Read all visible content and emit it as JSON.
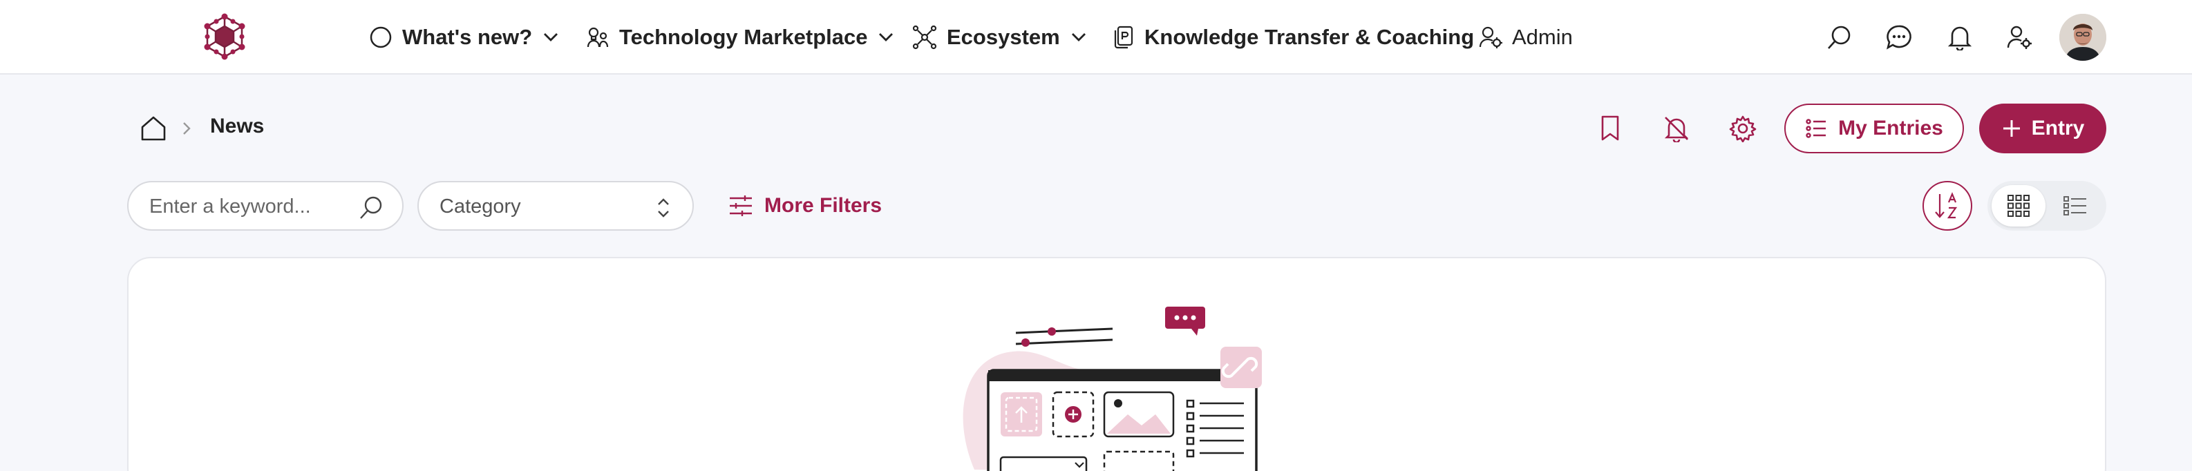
{
  "colors": {
    "accent": "#a11e4d",
    "accent_light": "#f3d9e2",
    "page_bg": "#f6f7fb"
  },
  "nav": {
    "logo_icon": "hexagon-network-logo-icon",
    "items": [
      {
        "label": "What's new?",
        "icon": "circle-icon",
        "dropdown": true
      },
      {
        "label": "Technology Marketplace",
        "icon": "lightbulb-people-icon",
        "dropdown": true
      },
      {
        "label": "Ecosystem",
        "icon": "network-icon",
        "dropdown": true
      },
      {
        "label": "Knowledge Transfer & Coaching",
        "icon": "document-icon",
        "dropdown": false
      },
      {
        "label": "Admin",
        "icon": "user-gear-icon",
        "dropdown": false
      }
    ],
    "right_icons": [
      "search-icon",
      "chat-icon",
      "bell-icon",
      "user-settings-icon"
    ],
    "avatar": "user-avatar"
  },
  "breadcrumb": {
    "home_icon": "home-icon",
    "current": "News"
  },
  "actions": {
    "icons": [
      "bookmark-icon",
      "bell-off-icon",
      "gear-icon"
    ],
    "my_entries_label": "My Entries",
    "entry_label": "Entry"
  },
  "filters": {
    "search_placeholder": "Enter a keyword...",
    "category_label": "Category",
    "more_filters_label": "More Filters"
  },
  "view": {
    "sort_icon": "sort-az-icon",
    "active": "grid"
  }
}
